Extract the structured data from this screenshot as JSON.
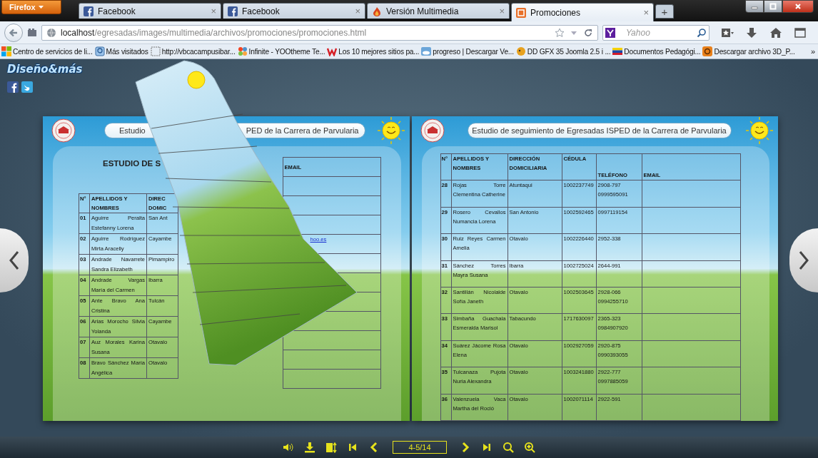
{
  "browser": {
    "menu_button": "Firefox",
    "tabs": [
      {
        "title": "Facebook",
        "kind": "facebook",
        "selected": false,
        "close": "×"
      },
      {
        "title": "Facebook",
        "kind": "facebook",
        "selected": false,
        "close": "×"
      },
      {
        "title": "Versión Multimedia",
        "kind": "flame",
        "selected": false,
        "close": "×"
      },
      {
        "title": "Promociones",
        "kind": "page",
        "selected": true,
        "close": "×"
      }
    ],
    "new_tab": "+",
    "address": {
      "host": "localhost",
      "path": "/egresadas/images/multimedia/archivos/promociones/promociones.html"
    },
    "search": {
      "placeholder": "Yahoo"
    },
    "bookmarks": [
      {
        "label": "Centro de servicios de li...",
        "kind": "windows"
      },
      {
        "label": "Más visitados",
        "kind": "history"
      },
      {
        "label": "http://vbcacampusibar...",
        "kind": "blank"
      },
      {
        "label": "Infinite - YOOtheme Te...",
        "kind": "joomla"
      },
      {
        "label": "Los 10 mejores sitios pa...",
        "kind": "w"
      },
      {
        "label": "progreso | Descargar Ve...",
        "kind": "cloud"
      },
      {
        "label": "DD GFX 35 Joomla 2.5 i ...",
        "kind": "bird"
      },
      {
        "label": "Documentos Pedagógi...",
        "kind": "flag"
      },
      {
        "label": "Descargar archivo 3D_P...",
        "kind": "orange"
      }
    ],
    "bookmarks_overflow": "»"
  },
  "site": {
    "logo": "Diseño&más"
  },
  "book": {
    "left_page": {
      "header_parts": [
        "Estudio",
        "PED de la Carrera de Parvularia"
      ],
      "heading": "ESTUDIO DE S",
      "columns": [
        "N°",
        "APELLIDOS Y NOMBRES",
        "DIREC DOMIC"
      ],
      "rows": [
        {
          "n": "01",
          "name": "Aguirre Peralta Estefanny Lorena",
          "address": "San Ant"
        },
        {
          "n": "02",
          "name": "Aguirre Rodríguez Mirta Aracelly",
          "address": "Cayambe"
        },
        {
          "n": "03",
          "name": "Andrade Navarrete Sandra Elizabeth",
          "address": "Pimampiro"
        },
        {
          "n": "04",
          "name": "Andrade Vargas María del Carmen",
          "address": "Ibarra"
        },
        {
          "n": "05",
          "name": "Ante Bravo Ana Cristina",
          "address": "Tulcán"
        },
        {
          "n": "06",
          "name": "Arias Morocho Silvia Yolanda",
          "address": "Cayambe"
        },
        {
          "n": "07",
          "name": "Auz Morales Karina Susana",
          "address": "Otavalo"
        },
        {
          "n": "08",
          "name": "Bravo Sánchez María Angélica",
          "address": "Otavalo"
        }
      ],
      "email_column": {
        "header": "EMAIL",
        "fragment": "hoo.es"
      }
    },
    "right_page": {
      "header": "Estudio de seguimiento de Egresadas ISPED de la Carrera de Parvularia",
      "columns": [
        "N°",
        "APELLIDOS Y NOMBRES",
        "DIRECCIÓN DOMICILIARIA",
        "CÉDULA",
        "TELÉFONO",
        "EMAIL"
      ],
      "rows": [
        {
          "n": "28",
          "name": "Rojas Torre Clementina Catherine",
          "address": "Atuntaqui",
          "id": "1002237749",
          "phones": [
            "2908-797",
            "0999595091"
          ]
        },
        {
          "n": "29",
          "name": "Rosero Cevallos Numancia Lorena",
          "address": "San Antonio",
          "id": "1002592465",
          "phones": [
            "0997119154"
          ]
        },
        {
          "n": "30",
          "name": "Ruiz Reyes Carmen Amelia",
          "address": "Otavalo",
          "id": "1002226440",
          "phones": [
            "2952-338"
          ]
        },
        {
          "n": "31",
          "name": "Sánchez Torres Mayra Susana",
          "address": "Ibarra",
          "id": "1002725024",
          "phones": [
            "2644-991"
          ]
        },
        {
          "n": "32",
          "name": "Santillán Nicolalde Sofía Janeth",
          "address": "Otavalo",
          "id": "1002503645",
          "phones": [
            "2928-066",
            "0994255710"
          ]
        },
        {
          "n": "33",
          "name": "Simbaña Guachala Esmeralda Marisol",
          "address": "Tabacundo",
          "id": "1717630097",
          "phones": [
            "2365-323",
            "0984907920"
          ]
        },
        {
          "n": "34",
          "name": "Suárez Jácome Rosa Elena",
          "address": "Otavalo",
          "id": "1002927059",
          "phones": [
            "2920-875",
            "0990393055"
          ]
        },
        {
          "n": "35",
          "name": "Tulcanaza Pujota Nuria Alexandra",
          "address": "Otavalo",
          "id": "1003241880",
          "phones": [
            "2922-777",
            "0997885059"
          ]
        },
        {
          "n": "36",
          "name": "Valenzuela Vaca Martha del Roció",
          "address": "Otavalo",
          "id": "1002071114",
          "phones": [
            "2922-591"
          ]
        }
      ]
    }
  },
  "toolbar": {
    "page_field": "4-5/14"
  }
}
